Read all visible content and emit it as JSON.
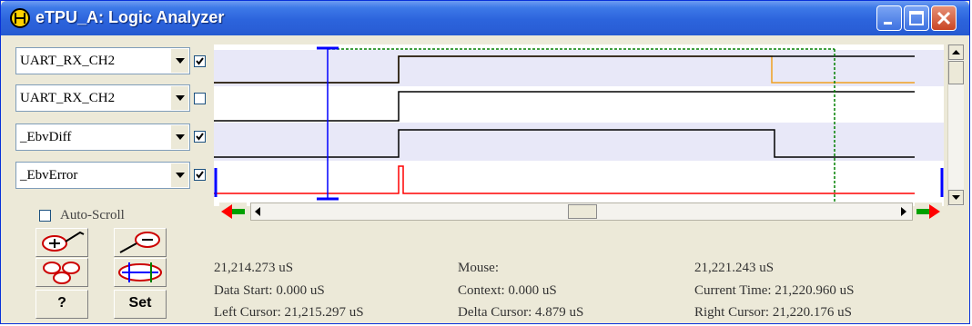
{
  "window": {
    "title": "eTPU_A: Logic Analyzer"
  },
  "channels": [
    {
      "name": "UART_RX_CH2",
      "checked": true
    },
    {
      "name": "UART_RX_CH2",
      "checked": false
    },
    {
      "name": "_EbvDiff",
      "checked": true
    },
    {
      "name": "_EbvError",
      "checked": true
    }
  ],
  "options": {
    "auto_scroll_label": "Auto-Scroll",
    "auto_scroll_checked": false
  },
  "tools": {
    "help_label": "?",
    "set_label": "Set"
  },
  "info": {
    "left_time": "21,214.273 uS",
    "data_start": "Data Start:   0.000 uS",
    "left_cursor": "Left Cursor: 21,215.297 uS",
    "mouse": "Mouse:",
    "context": "Context: 0.000 uS",
    "delta_cursor": "Delta Cursor:   4.879 uS",
    "right_time": "21,221.243 uS",
    "current_time": "Current Time:  21,220.960 uS",
    "right_cursor": "Right Cursor: 21,220.176 uS"
  },
  "colors": {
    "trace_black": "#000000",
    "trace_orange": "#f0a020",
    "trace_red": "#ff0000",
    "left_cursor": "#0000ff",
    "right_cursor": "#008000",
    "row_shade": "#e8e8f8",
    "arrow_green": "#00a000",
    "arrow_red": "#ff0000"
  }
}
